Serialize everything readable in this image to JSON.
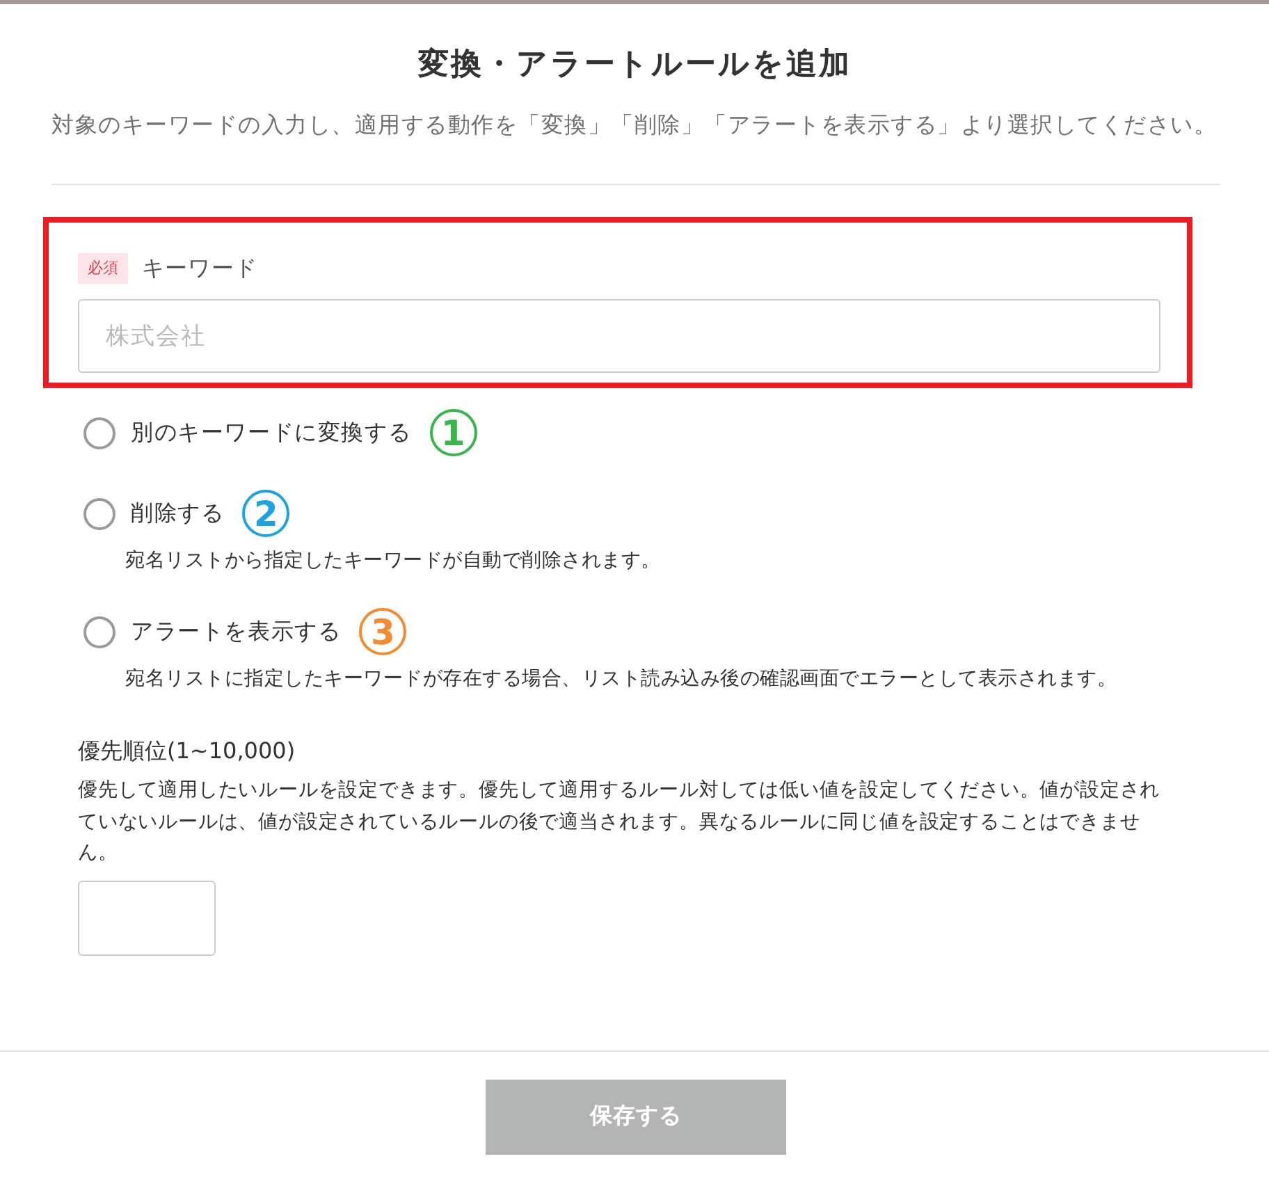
{
  "dialog": {
    "title": "変換・アラートルールを追加",
    "description": "対象のキーワードの入力し、適用する動作を「変換」「削除」「アラートを表示する」より選択してください。"
  },
  "keyword_field": {
    "highlighted": true,
    "required_badge": "必須",
    "label": "キーワード",
    "placeholder": "株式会社"
  },
  "actions": [
    {
      "label": "別のキーワードに変換する",
      "selected": false,
      "badge": "1",
      "color": "#3ab54a"
    },
    {
      "label": "削除する",
      "selected": false,
      "badge": "2",
      "color": "#1ca3e3",
      "description": "宛名リストから指定したキーワードが自動で削除されます。"
    },
    {
      "label": "アラートを表示する",
      "selected": false,
      "badge": "3",
      "color": "#f58b2e",
      "description": "宛名リストに指定したキーワードが存在する場合、リスト読み込み後の確認画面でエラーとして表示されます。"
    }
  ],
  "priority": {
    "label": "優先順位(1~10,000)",
    "help": "優先して適用したいルールを設定できます。優先して適用するルール対しては低い値を設定してください。値が設定されていないルールは、値が設定されているルールの後で適当されます。異なるルールに同じ値を設定することはできません。"
  },
  "footer": {
    "save_button": {
      "label": "保存する",
      "disabled": true
    }
  }
}
